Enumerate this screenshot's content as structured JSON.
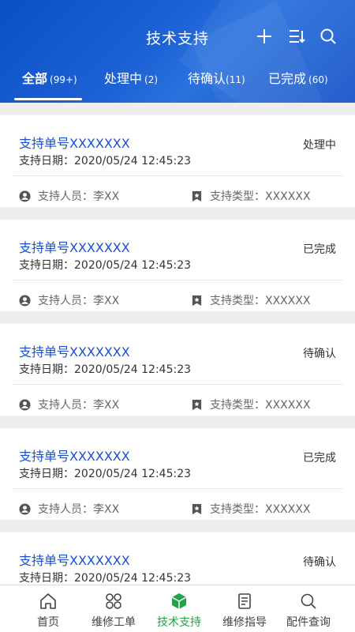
{
  "header": {
    "title": "技术支持"
  },
  "tabs": [
    {
      "label": "全部",
      "count": "(99+)",
      "active": true
    },
    {
      "label": "处理中",
      "count": "(2)"
    },
    {
      "label": "待确认",
      "count": "(11)"
    },
    {
      "label": "已完成",
      "count": "(60)"
    }
  ],
  "items": [
    {
      "no": "支持单号XXXXXXX",
      "status": "处理中",
      "date": "支持日期：2020/05/24 12:45:23",
      "person": "支持人员：李XX",
      "type": "支持类型：XXXXXX"
    },
    {
      "no": "支持单号XXXXXXX",
      "status": "已完成",
      "date": "支持日期：2020/05/24 12:45:23",
      "person": "支持人员：李XX",
      "type": "支持类型：XXXXXX"
    },
    {
      "no": "支持单号XXXXXXX",
      "status": "待确认",
      "date": "支持日期：2020/05/24 12:45:23",
      "person": "支持人员：李XX",
      "type": "支持类型：XXXXXX"
    },
    {
      "no": "支持单号XXXXXXX",
      "status": "已完成",
      "date": "支持日期：2020/05/24 12:45:23",
      "person": "支持人员：李XX",
      "type": "支持类型：XXXXXX"
    },
    {
      "no": "支持单号XXXXXXX",
      "status": "待确认",
      "date": "支持日期：2020/05/24 12:45:23"
    }
  ],
  "bottom_nav": [
    {
      "label": "首页",
      "icon": "home-icon"
    },
    {
      "label": "维修工单",
      "icon": "grid-icon"
    },
    {
      "label": "技术支持",
      "icon": "cube-icon",
      "active": true
    },
    {
      "label": "维修指导",
      "icon": "document-icon"
    },
    {
      "label": "配件查询",
      "icon": "search-icon"
    }
  ],
  "colors": {
    "header_blue": "#1d63d6",
    "link_blue": "#1b4fd0",
    "active_green": "#22a349"
  }
}
